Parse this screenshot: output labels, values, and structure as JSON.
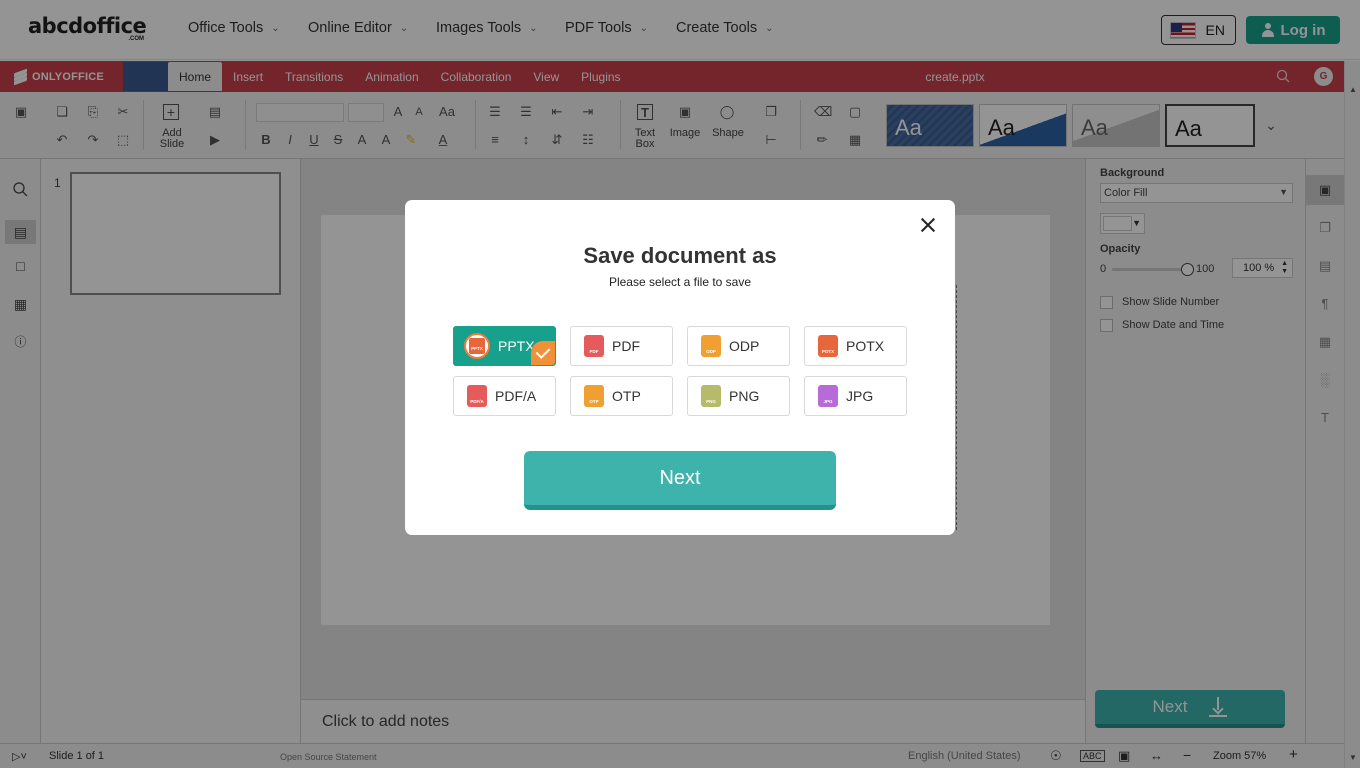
{
  "site": {
    "logo_main": "abcdoffice",
    "logo_sub": ".COM",
    "nav": [
      {
        "label": "Office Tools"
      },
      {
        "label": "Online Editor"
      },
      {
        "label": "Images Tools"
      },
      {
        "label": "PDF Tools"
      },
      {
        "label": "Create Tools"
      }
    ],
    "language": "EN",
    "login": "Log in"
  },
  "editor": {
    "brand": "ONLYOFFICE",
    "tabs": [
      "Home",
      "Insert",
      "Transitions",
      "Animation",
      "Collaboration",
      "View",
      "Plugins"
    ],
    "active_tab": "Home",
    "doc_title": "create.pptx",
    "user_initial": "G",
    "toolbar": {
      "add_slide_l1": "Add",
      "add_slide_l2": "Slide",
      "textbox_l1": "Text",
      "textbox_l2": "Box",
      "image": "Image",
      "shape": "Shape",
      "theme_label": "Aa"
    },
    "slide_number": "1",
    "notes_placeholder": "Click to add notes",
    "right_panel": {
      "background_label": "Background",
      "fill_value": "Color Fill",
      "opacity_label": "Opacity",
      "opacity_min": "0",
      "opacity_max": "100",
      "opacity_value": "100 %",
      "show_slide_number": "Show Slide Number",
      "show_date_time": "Show Date and Time",
      "next_label": "Next"
    },
    "status": {
      "slide_of": "Slide 1 of 1",
      "open_source": "Open Source Statement",
      "language": "English (United States)",
      "zoom": "Zoom 57%"
    }
  },
  "dialog": {
    "title": "Save document as",
    "subtitle": "Please select a file to save",
    "formats": [
      {
        "label": "PPTX",
        "tag": "PPTX",
        "color": "#e8673a",
        "selected": true
      },
      {
        "label": "PDF",
        "tag": "PDF",
        "color": "#e55a5a",
        "selected": false
      },
      {
        "label": "ODP",
        "tag": "ODP",
        "color": "#f0a030",
        "selected": false
      },
      {
        "label": "POTX",
        "tag": "POTX",
        "color": "#e8673a",
        "selected": false
      },
      {
        "label": "PDF/A",
        "tag": "PDF/A",
        "color": "#e55a5a",
        "selected": false
      },
      {
        "label": "OTP",
        "tag": "OTP",
        "color": "#f0a030",
        "selected": false
      },
      {
        "label": "PNG",
        "tag": "PNG",
        "color": "#b5bb6a",
        "selected": false
      },
      {
        "label": "JPG",
        "tag": "JPG",
        "color": "#b86ad8",
        "selected": false
      }
    ],
    "next_label": "Next"
  }
}
